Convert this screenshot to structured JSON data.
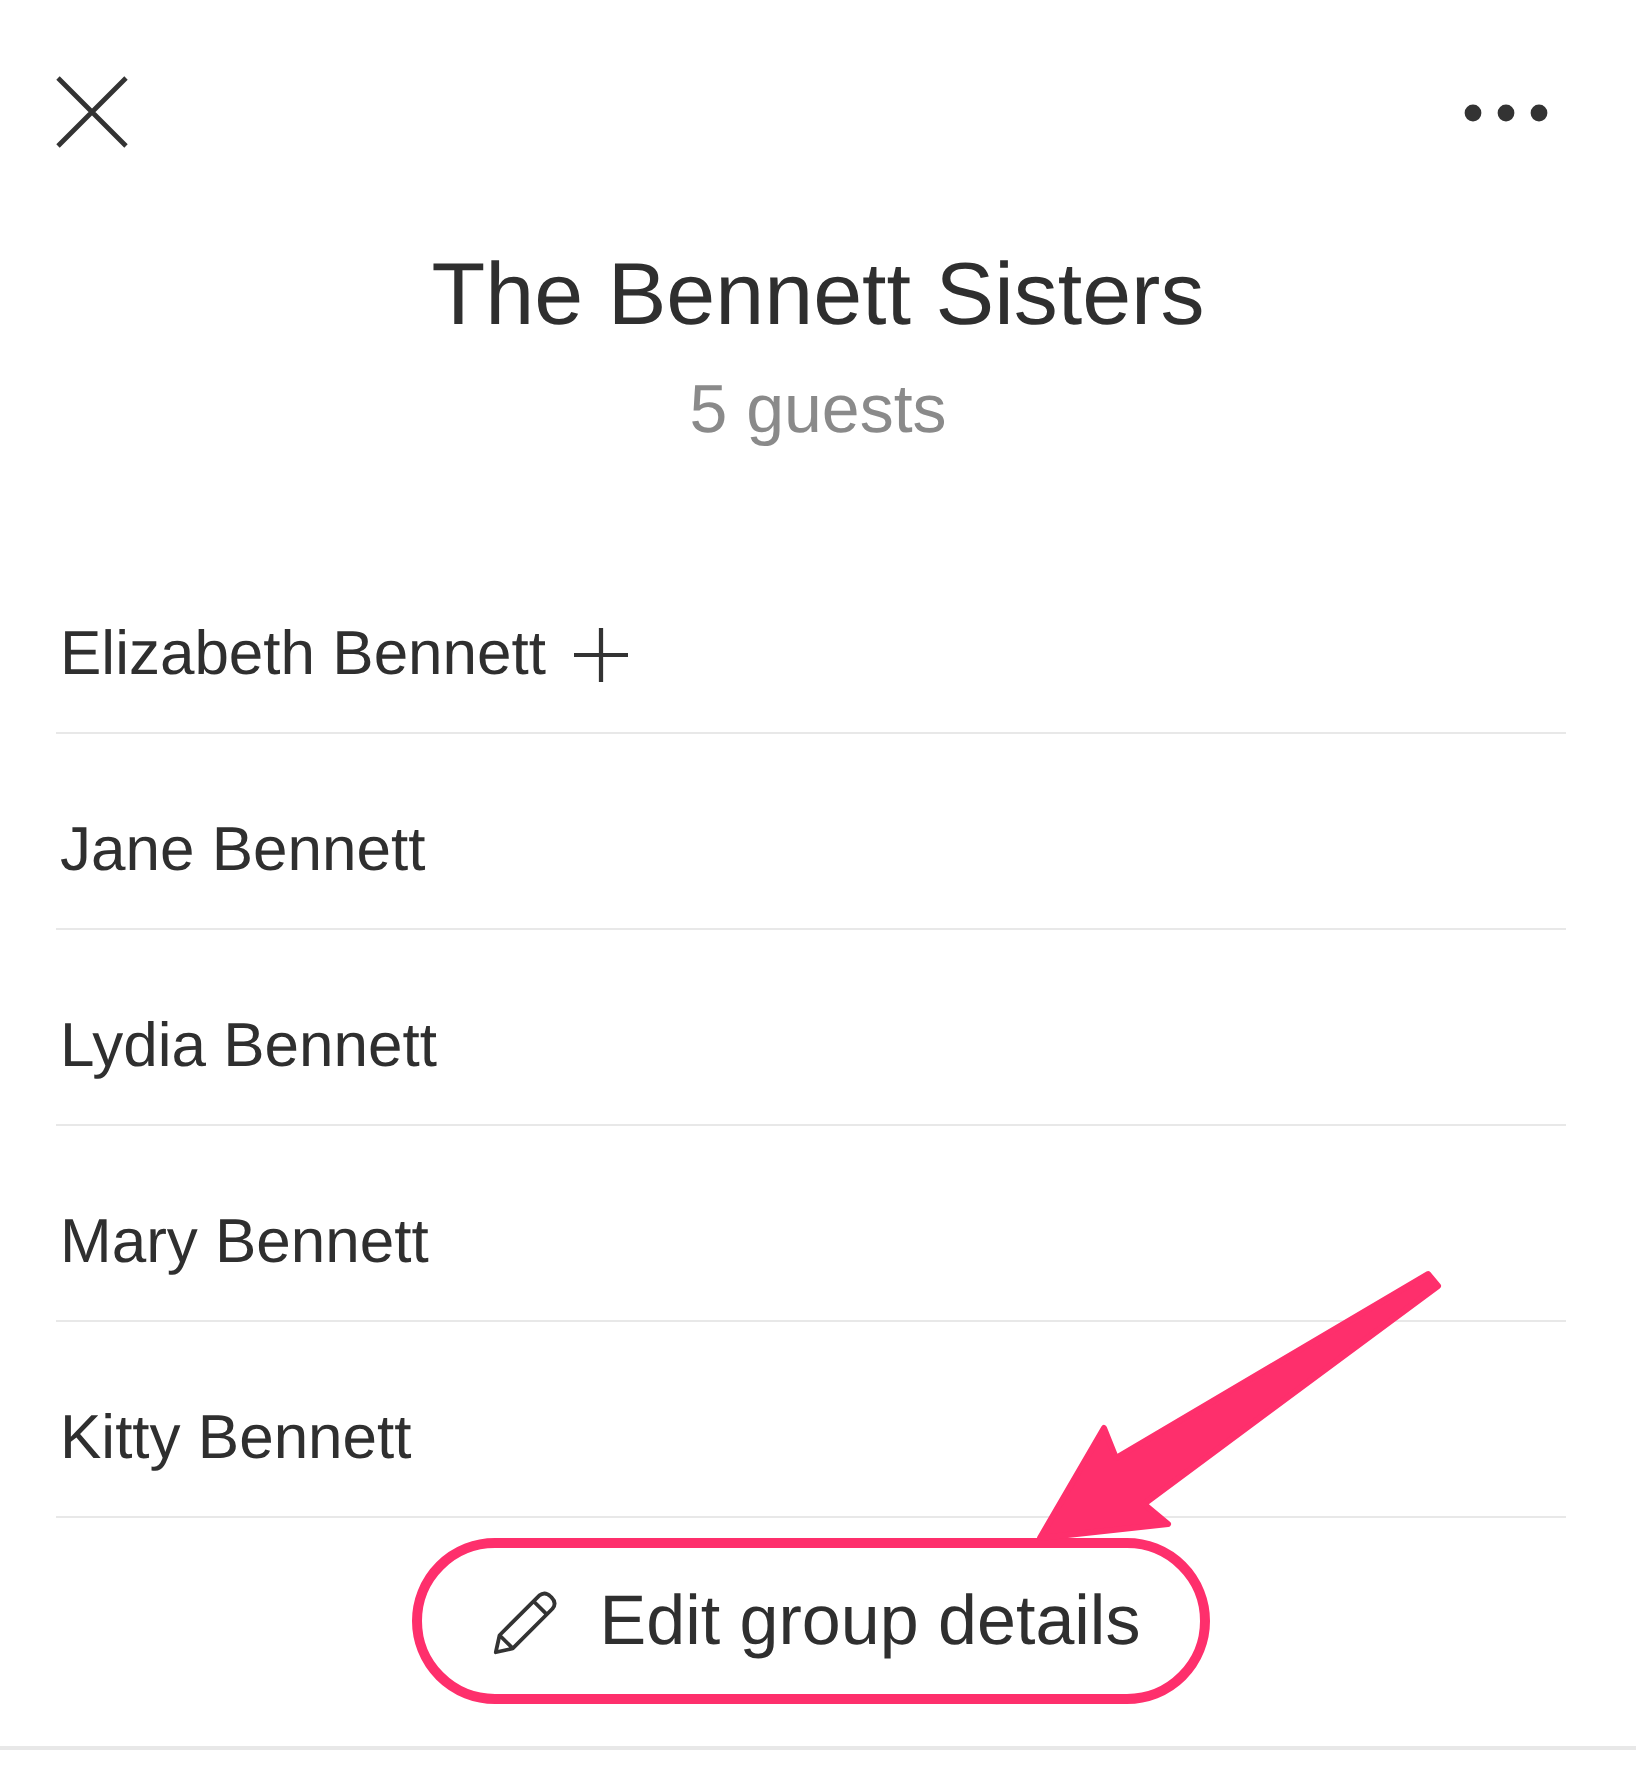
{
  "header": {
    "title": "The Bennett Sisters",
    "subtitle": "5 guests"
  },
  "guests": [
    {
      "name": "Elizabeth Bennett",
      "plus_one": true
    },
    {
      "name": "Jane Bennett",
      "plus_one": false
    },
    {
      "name": "Lydia Bennett",
      "plus_one": false
    },
    {
      "name": "Mary Bennett",
      "plus_one": false
    },
    {
      "name": "Kitty Bennett",
      "plus_one": false
    }
  ],
  "edit_button": {
    "label": "Edit group details",
    "highlighted": true
  }
}
